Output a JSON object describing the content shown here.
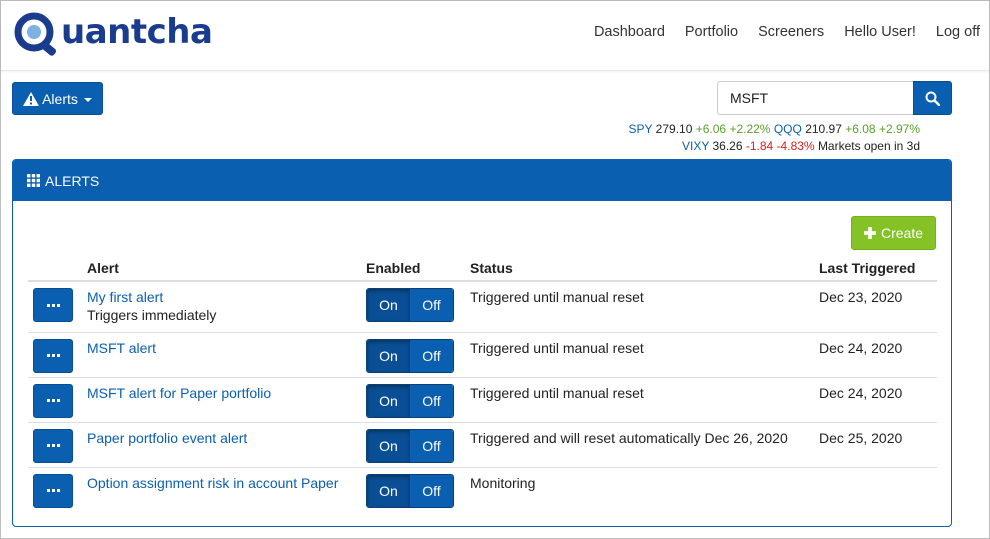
{
  "brand": {
    "name": "uantcha"
  },
  "nav": {
    "links": [
      "Dashboard",
      "Portfolio",
      "Screeners",
      "Hello User!",
      "Log off"
    ]
  },
  "alerts_menu": {
    "label": "Alerts"
  },
  "search": {
    "value": "MSFT"
  },
  "ticker": {
    "spy": {
      "symbol": "SPY",
      "price": "279.10",
      "change": "+6.06",
      "pct": "+2.22%"
    },
    "qqq": {
      "symbol": "QQQ",
      "price": "210.97",
      "change": "+6.08",
      "pct": "+2.97%"
    },
    "vixy": {
      "symbol": "VIXY",
      "price": "36.26",
      "change": "-1.84",
      "pct": "-4.83%"
    },
    "market_status": "Markets open in 3d"
  },
  "panel": {
    "title": "ALERTS",
    "create_label": "Create",
    "columns": {
      "alert": "Alert",
      "enabled": "Enabled",
      "status": "Status",
      "last": "Last Triggered"
    },
    "toggle": {
      "on": "On",
      "off": "Off"
    },
    "rows": [
      {
        "name": "My first alert",
        "sub": "Triggers immediately",
        "status": "Triggered until manual reset",
        "last": "Dec 23, 2020"
      },
      {
        "name": "MSFT alert",
        "sub": "",
        "status": "Triggered until manual reset",
        "last": "Dec 24, 2020"
      },
      {
        "name": "MSFT alert for Paper portfolio",
        "sub": "",
        "status": "Triggered until manual reset",
        "last": "Dec 24, 2020"
      },
      {
        "name": "Paper portfolio event alert",
        "sub": "",
        "status": "Triggered and will reset automatically Dec 26, 2020",
        "last": "Dec 25, 2020"
      },
      {
        "name": "Option assignment risk in account Paper",
        "sub": "",
        "status": "Monitoring",
        "last": ""
      }
    ]
  },
  "colors": {
    "primary": "#0b5fb0",
    "success": "#84c225",
    "up": "#5aa02c",
    "down": "#d42020",
    "logo": "#1a3c8f"
  },
  "icons": [
    "logo-q-icon",
    "warning-icon",
    "caret-down-icon",
    "search-icon",
    "grid-icon",
    "plus-icon",
    "ellipsis-icon"
  ]
}
